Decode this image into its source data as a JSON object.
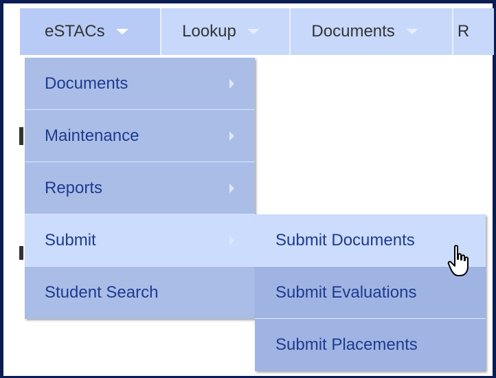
{
  "topnav": {
    "items": [
      {
        "label": "eSTACs"
      },
      {
        "label": "Lookup"
      },
      {
        "label": "Documents"
      },
      {
        "label": "R"
      }
    ]
  },
  "menu": {
    "items": [
      {
        "label": "Documents"
      },
      {
        "label": "Maintenance"
      },
      {
        "label": "Reports"
      },
      {
        "label": "Submit"
      },
      {
        "label": "Student Search"
      }
    ]
  },
  "submenu": {
    "items": [
      {
        "label": "Submit Documents"
      },
      {
        "label": "Submit Evaluations"
      },
      {
        "label": "Submit Placements"
      }
    ]
  },
  "colors": {
    "frame": "#0b1c52",
    "nav_bg": "#c7d8fb",
    "menu_bg": "#a9bde7",
    "hover_bg": "#cbdcfc",
    "text": "#1f3a8f"
  },
  "icons": [
    "chevron-down-icon",
    "chevron-right-icon",
    "hand-pointer-cursor-icon"
  ]
}
